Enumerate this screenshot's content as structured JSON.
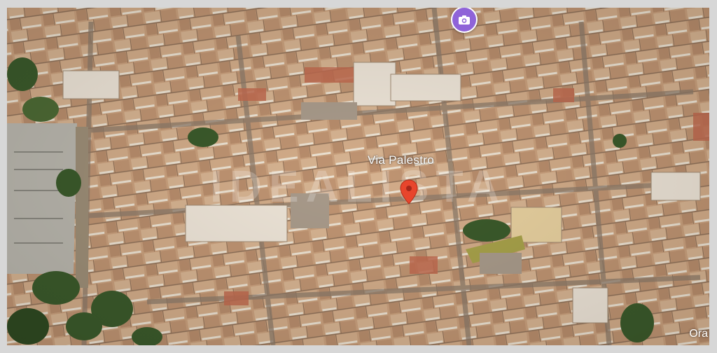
{
  "map": {
    "view": "aerial-3d",
    "street_label": "Via Palestro",
    "watermark_text": "IDEALISTA",
    "corner_text": "Ora",
    "marker_icon": "location-pin-icon",
    "photo_button_icon": "camera-icon",
    "colors": {
      "roof": "#c9a07d",
      "roof_red": "#c06a4f",
      "wall": "#e8dccb",
      "street": "#8d7b6a",
      "greenery": "#3b5a2b",
      "marker": "#e8452c",
      "photo_button": "#8f63d8"
    }
  }
}
